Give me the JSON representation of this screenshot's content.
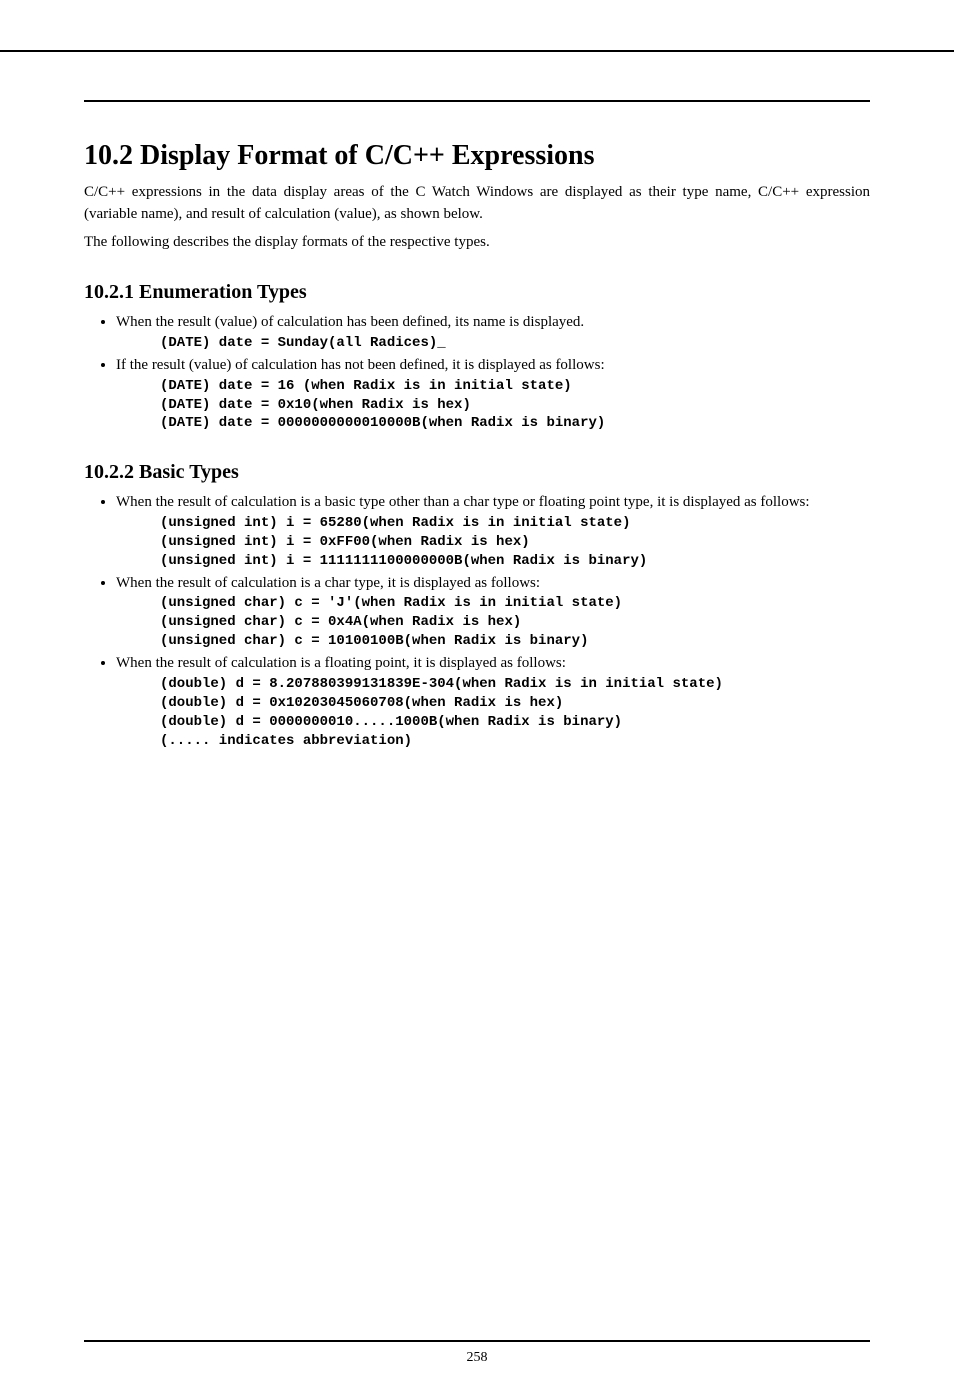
{
  "title": "10.2 Display Format of C/C++ Expressions",
  "intro_p1": "C/C++ expressions in the data display areas of the C Watch Windows are displayed as their type name, C/C++ expression (variable name), and result of calculation (value), as shown below.",
  "intro_p2": "The following describes the display formats of the respective types.",
  "section1": {
    "heading": "10.2.1 Enumeration Types",
    "b1_text": "When the result (value) of calculation has been defined, its name is displayed.",
    "b1_code": "(DATE) date = Sunday(all Radices)_",
    "b2_text": "If the result (value) of calculation has not been defined, it is displayed as follows:",
    "b2_code": "(DATE) date = 16 (when Radix is in initial state)\n(DATE) date = 0x10(when Radix is hex)\n(DATE) date = 0000000000010000B(when Radix is binary)"
  },
  "section2": {
    "heading": "10.2.2 Basic Types",
    "b1_text": "When the result of calculation is a basic type other than a char type or floating point type, it is displayed as follows:",
    "b1_code": "(unsigned int) i = 65280(when Radix is in initial state)\n(unsigned int) i = 0xFF00(when Radix is hex)\n(unsigned int) i = 1111111100000000B(when Radix is binary)",
    "b2_text": "When the result of calculation is a char type, it is displayed as follows:",
    "b2_code": "(unsigned char) c = 'J'(when Radix is in initial state)\n(unsigned char) c = 0x4A(when Radix is hex)\n(unsigned char) c = 10100100B(when Radix is binary)",
    "b3_text": "When the result of calculation is a floating point, it is displayed as follows:",
    "b3_code": "(double) d = 8.207880399131839E-304(when Radix is in initial state)\n(double) d = 0x10203045060708(when Radix is hex)\n(double) d = 0000000010.....1000B(when Radix is binary)\n(..... indicates abbreviation)"
  },
  "page_number": "258"
}
